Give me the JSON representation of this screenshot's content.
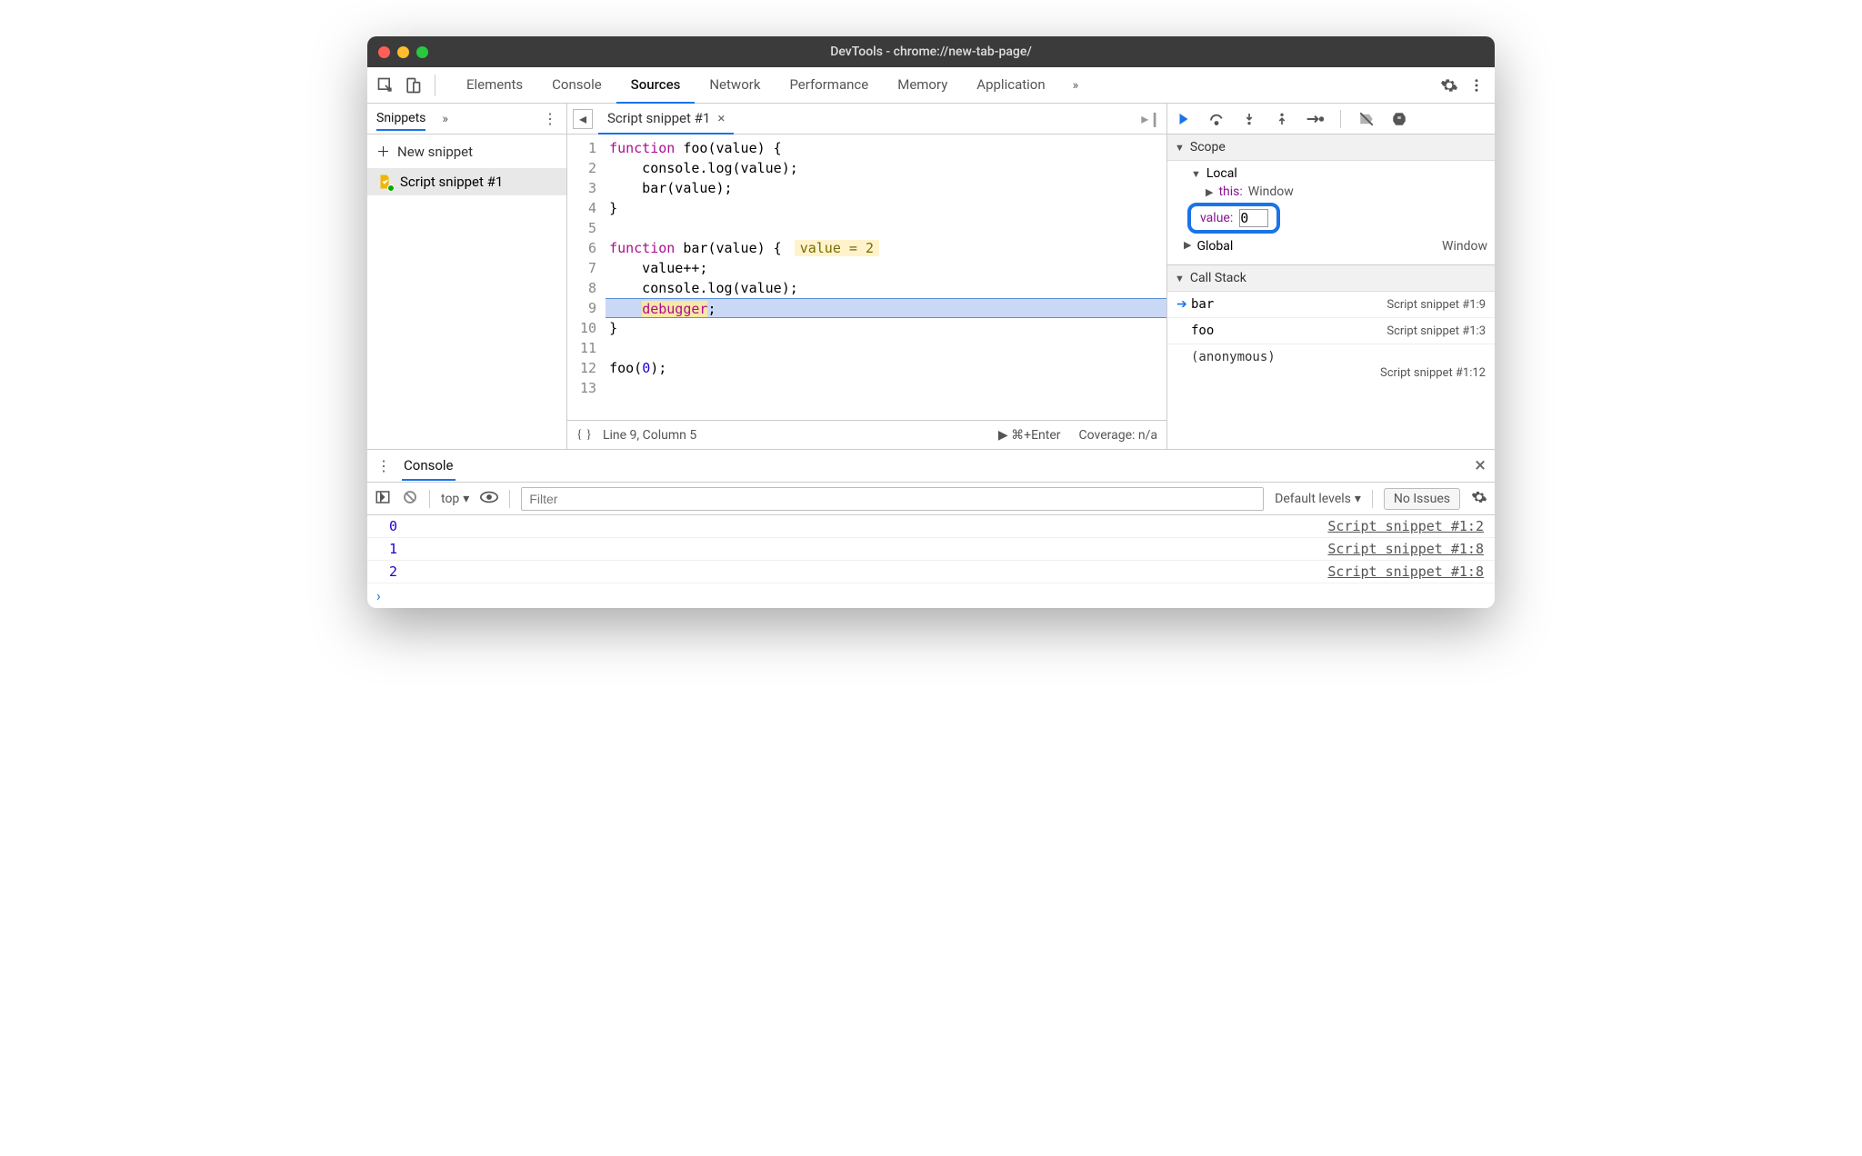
{
  "window": {
    "title": "DevTools - chrome://new-tab-page/"
  },
  "toolbar": {
    "tabs": [
      "Elements",
      "Console",
      "Sources",
      "Network",
      "Performance",
      "Memory",
      "Application"
    ],
    "active_index": 2
  },
  "sidebar": {
    "header_tab": "Snippets",
    "new_snippet": "New snippet",
    "items": [
      {
        "label": "Script snippet #1"
      }
    ]
  },
  "editor": {
    "open_tab": "Script snippet #1",
    "lines": [
      {
        "n": 1,
        "segments": [
          [
            "kw",
            "function"
          ],
          [
            "",
            " "
          ],
          [
            "fn",
            "foo"
          ],
          [
            "",
            "(value) {"
          ]
        ]
      },
      {
        "n": 2,
        "segments": [
          [
            "",
            "    console.log(value);"
          ]
        ]
      },
      {
        "n": 3,
        "segments": [
          [
            "",
            "    bar(value);"
          ]
        ]
      },
      {
        "n": 4,
        "segments": [
          [
            "",
            "}"
          ]
        ]
      },
      {
        "n": 5,
        "segments": [
          [
            "",
            ""
          ]
        ]
      },
      {
        "n": 6,
        "segments": [
          [
            "kw",
            "function"
          ],
          [
            "",
            " "
          ],
          [
            "fn",
            "bar"
          ],
          [
            "",
            "(value) {"
          ]
        ],
        "hint": "value = 2"
      },
      {
        "n": 7,
        "segments": [
          [
            "",
            "    value++;"
          ]
        ]
      },
      {
        "n": 8,
        "segments": [
          [
            "",
            "    console.log(value);"
          ]
        ]
      },
      {
        "n": 9,
        "hl": true,
        "segments": [
          [
            "",
            "    "
          ],
          [
            "dbg",
            "debugger"
          ],
          [
            "",
            ";"
          ]
        ]
      },
      {
        "n": 10,
        "segments": [
          [
            "",
            "}"
          ]
        ]
      },
      {
        "n": 11,
        "segments": [
          [
            "",
            ""
          ]
        ]
      },
      {
        "n": 12,
        "segments": [
          [
            "",
            "foo("
          ],
          [
            "num",
            "0"
          ],
          [
            "",
            ");"
          ]
        ]
      },
      {
        "n": 13,
        "segments": [
          [
            "",
            ""
          ]
        ]
      }
    ],
    "status": {
      "position": "Line 9, Column 5",
      "run_hint": "⌘+Enter",
      "coverage": "Coverage: n/a"
    }
  },
  "debug": {
    "scope_label": "Scope",
    "local_label": "Local",
    "this_label": "this",
    "this_value": "Window",
    "edit_name": "value",
    "edit_value": "0",
    "global_label": "Global",
    "global_value": "Window",
    "callstack_label": "Call Stack",
    "frames": [
      {
        "name": "bar",
        "loc": "Script snippet #1:9",
        "active": true
      },
      {
        "name": "foo",
        "loc": "Script snippet #1:3",
        "active": false
      }
    ],
    "anon_label": "(anonymous)",
    "anon_loc": "Script snippet #1:12"
  },
  "drawer": {
    "tab": "Console",
    "toolbar": {
      "context": "top",
      "filter_placeholder": "Filter",
      "levels": "Default levels",
      "issues": "No Issues"
    },
    "rows": [
      {
        "value": "0",
        "loc": "Script snippet #1:2"
      },
      {
        "value": "1",
        "loc": "Script snippet #1:8"
      },
      {
        "value": "2",
        "loc": "Script snippet #1:8"
      }
    ]
  }
}
